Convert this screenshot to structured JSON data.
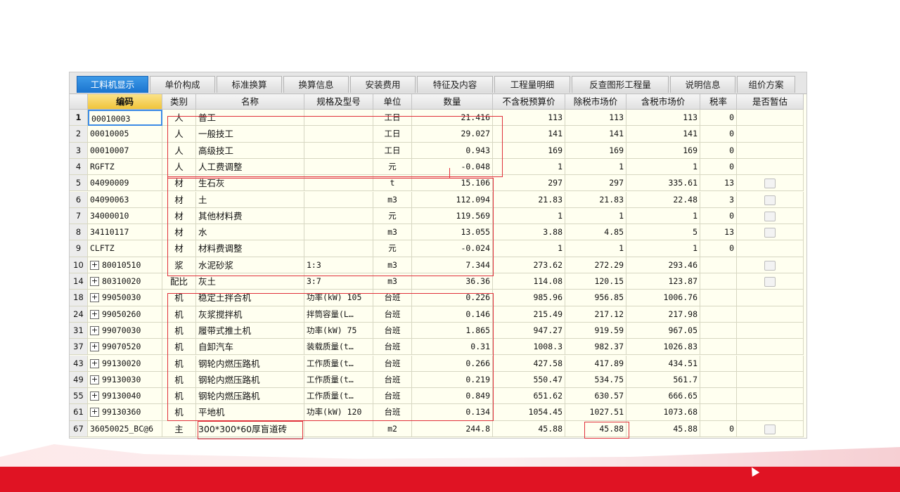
{
  "tabs": [
    "工料机显示",
    "单价构成",
    "标准换算",
    "换算信息",
    "安装费用",
    "特征及内容",
    "工程量明细",
    "反查图形工程量",
    "说明信息",
    "组价方案"
  ],
  "active_tab": 0,
  "columns": [
    "编码",
    "类别",
    "名称",
    "规格及型号",
    "单位",
    "数量",
    "不含税预算价",
    "除税市场价",
    "含税市场价",
    "税率",
    "是否暂估"
  ],
  "rows": [
    {
      "idx": "1",
      "code": "00010003",
      "type": "人",
      "name": "普工",
      "spec": "",
      "unit": "工日",
      "qty": "21.416",
      "budget": "113",
      "market": "113",
      "taxed": "113",
      "rate": "0",
      "est": false,
      "exp": false
    },
    {
      "idx": "2",
      "code": "00010005",
      "type": "人",
      "name": "一般技工",
      "spec": "",
      "unit": "工日",
      "qty": "29.027",
      "budget": "141",
      "market": "141",
      "taxed": "141",
      "rate": "0",
      "est": false,
      "exp": false
    },
    {
      "idx": "3",
      "code": "00010007",
      "type": "人",
      "name": "高级技工",
      "spec": "",
      "unit": "工日",
      "qty": "0.943",
      "budget": "169",
      "market": "169",
      "taxed": "169",
      "rate": "0",
      "est": false,
      "exp": false
    },
    {
      "idx": "4",
      "code": "RGFTZ",
      "type": "人",
      "name": "人工费调整",
      "spec": "",
      "unit": "元",
      "qty": "-0.048",
      "budget": "1",
      "market": "1",
      "taxed": "1",
      "rate": "0",
      "est": false,
      "exp": false
    },
    {
      "idx": "5",
      "code": "04090009",
      "type": "材",
      "name": "生石灰",
      "spec": "",
      "unit": "t",
      "qty": "15.106",
      "budget": "297",
      "market": "297",
      "taxed": "335.61",
      "rate": "13",
      "est": true,
      "exp": false
    },
    {
      "idx": "6",
      "code": "04090063",
      "type": "材",
      "name": "土",
      "spec": "",
      "unit": "m3",
      "qty": "112.094",
      "budget": "21.83",
      "market": "21.83",
      "taxed": "22.48",
      "rate": "3",
      "est": true,
      "exp": false
    },
    {
      "idx": "7",
      "code": "34000010",
      "type": "材",
      "name": "其他材料费",
      "spec": "",
      "unit": "元",
      "qty": "119.569",
      "budget": "1",
      "market": "1",
      "taxed": "1",
      "rate": "0",
      "est": true,
      "exp": false
    },
    {
      "idx": "8",
      "code": "34110117",
      "type": "材",
      "name": "水",
      "spec": "",
      "unit": "m3",
      "qty": "13.055",
      "budget": "3.88",
      "market": "4.85",
      "taxed": "5",
      "rate": "13",
      "est": true,
      "exp": false
    },
    {
      "idx": "9",
      "code": "CLFTZ",
      "type": "材",
      "name": "材料费调整",
      "spec": "",
      "unit": "元",
      "qty": "-0.024",
      "budget": "1",
      "market": "1",
      "taxed": "1",
      "rate": "0",
      "est": false,
      "exp": false
    },
    {
      "idx": "10",
      "code": "80010510",
      "type": "浆",
      "name": "水泥砂浆",
      "spec": "1:3",
      "unit": "m3",
      "qty": "7.344",
      "budget": "273.62",
      "market": "272.29",
      "taxed": "293.46",
      "rate": "",
      "est": true,
      "exp": true
    },
    {
      "idx": "14",
      "code": "80310020",
      "type": "配比",
      "name": "灰土",
      "spec": "3:7",
      "unit": "m3",
      "qty": "36.36",
      "budget": "114.08",
      "market": "120.15",
      "taxed": "123.87",
      "rate": "",
      "est": true,
      "exp": true
    },
    {
      "idx": "18",
      "code": "99050030",
      "type": "机",
      "name": "稳定土拌合机",
      "spec": "功率(kW) 105",
      "unit": "台班",
      "qty": "0.226",
      "budget": "985.96",
      "market": "956.85",
      "taxed": "1006.76",
      "rate": "",
      "est": false,
      "exp": true
    },
    {
      "idx": "24",
      "code": "99050260",
      "type": "机",
      "name": "灰浆搅拌机",
      "spec": "拌筒容量(L…",
      "unit": "台班",
      "qty": "0.146",
      "budget": "215.49",
      "market": "217.12",
      "taxed": "217.98",
      "rate": "",
      "est": false,
      "exp": true
    },
    {
      "idx": "31",
      "code": "99070030",
      "type": "机",
      "name": "履带式推土机",
      "spec": "功率(kW) 75",
      "unit": "台班",
      "qty": "1.865",
      "budget": "947.27",
      "market": "919.59",
      "taxed": "967.05",
      "rate": "",
      "est": false,
      "exp": true
    },
    {
      "idx": "37",
      "code": "99070520",
      "type": "机",
      "name": "自卸汽车",
      "spec": "装载质量(t…",
      "unit": "台班",
      "qty": "0.31",
      "budget": "1008.3",
      "market": "982.37",
      "taxed": "1026.83",
      "rate": "",
      "est": false,
      "exp": true
    },
    {
      "idx": "43",
      "code": "99130020",
      "type": "机",
      "name": "钢轮内燃压路机",
      "spec": "工作质量(t…",
      "unit": "台班",
      "qty": "0.266",
      "budget": "427.58",
      "market": "417.89",
      "taxed": "434.51",
      "rate": "",
      "est": false,
      "exp": true
    },
    {
      "idx": "49",
      "code": "99130030",
      "type": "机",
      "name": "钢轮内燃压路机",
      "spec": "工作质量(t…",
      "unit": "台班",
      "qty": "0.219",
      "budget": "550.47",
      "market": "534.75",
      "taxed": "561.7",
      "rate": "",
      "est": false,
      "exp": true
    },
    {
      "idx": "55",
      "code": "99130040",
      "type": "机",
      "name": "钢轮内燃压路机",
      "spec": "工作质量(t…",
      "unit": "台班",
      "qty": "0.849",
      "budget": "651.62",
      "market": "630.57",
      "taxed": "666.65",
      "rate": "",
      "est": false,
      "exp": true
    },
    {
      "idx": "61",
      "code": "99130360",
      "type": "机",
      "name": "平地机",
      "spec": "功率(kW) 120",
      "unit": "台班",
      "qty": "0.134",
      "budget": "1054.45",
      "market": "1027.51",
      "taxed": "1073.68",
      "rate": "",
      "est": false,
      "exp": true
    },
    {
      "idx": "67",
      "code": "36050025_BC@6",
      "type": "主",
      "name": "300*300*60厚盲道砖",
      "spec": "",
      "unit": "m2",
      "qty": "244.8",
      "budget": "45.88",
      "market": "45.88",
      "taxed": "45.88",
      "rate": "0",
      "est": true,
      "exp": false
    }
  ],
  "colors": {
    "annotation": "#e0303a",
    "active_tab": "#1a74cf",
    "code_header": "#f0c43a",
    "brand_bar": "#e01323"
  }
}
